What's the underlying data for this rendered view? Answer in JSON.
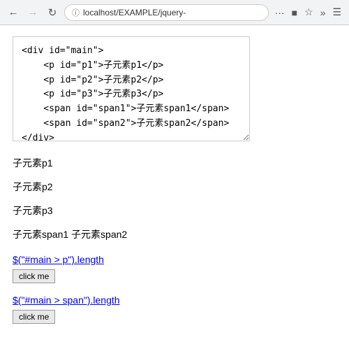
{
  "browser": {
    "url": "localhost/EXAMPLE/jquery-",
    "url_prefix_icon": "ℹ"
  },
  "code": {
    "lines": [
      "<div id=\"main\">",
      "    <p id=\"p1\">子元素p1</p>",
      "    <p id=\"p2\">子元素p2</p>",
      "    <p id=\"p3\">子元素p3</p>",
      "    <span id=\"span1\">子元素span1</span>",
      "    <span id=\"span2\">子元素span2</span>",
      "</div>"
    ]
  },
  "children": {
    "p1": "子元素p1",
    "p2": "子元素p2",
    "p3": "子元素p3",
    "span_line": "子元素span1 子元素span2"
  },
  "sections": [
    {
      "selector": "$(\"#main > p\").length",
      "button_label": "click me"
    },
    {
      "selector": "$(\"#main > span\").length",
      "button_label": "click me"
    }
  ],
  "nav": {
    "back": "←",
    "forward": "→",
    "reload": "↻",
    "dots": "···",
    "bookmark": "☆",
    "star": "♡",
    "more1": "»",
    "more2": "≡"
  }
}
